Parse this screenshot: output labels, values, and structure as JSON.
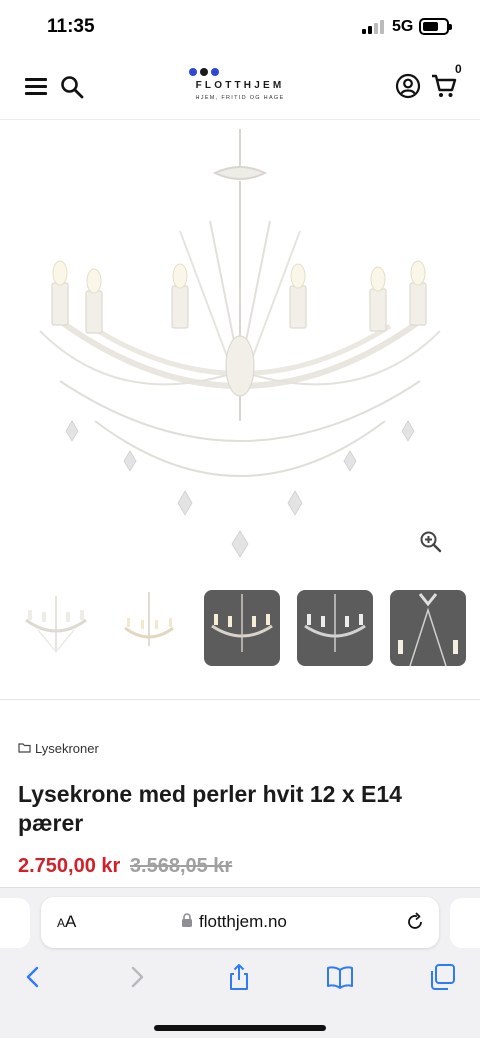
{
  "status_bar": {
    "time": "11:35",
    "network": "5G"
  },
  "header": {
    "logo_name": "FLOTTHJEM",
    "logo_tagline": "HJEM, FRITID OG HAGE",
    "cart_count": "0"
  },
  "colors": {
    "accent": "#2d49d6",
    "price_red": "#d0202a",
    "old_price_grey": "#a0a0a0",
    "link_blue": "#2f7bf6"
  },
  "icons": [
    "menu-icon",
    "search-icon",
    "account-icon",
    "cart-icon",
    "zoom-in-icon",
    "folder-icon",
    "lock-icon",
    "reload-icon",
    "back-icon",
    "forward-icon",
    "share-icon",
    "bookmarks-icon",
    "tabs-icon"
  ],
  "product": {
    "category": "Lysekroner",
    "title": "Lysekrone med perler hvit 12 x E14 pærer",
    "price": "2.750,00 kr",
    "old_price": "3.568,05 kr",
    "gallery_count": 5,
    "selected_image": 1
  },
  "browser": {
    "aa_label_small": "A",
    "aa_label_large": "A",
    "url": "flotthjem.no"
  }
}
